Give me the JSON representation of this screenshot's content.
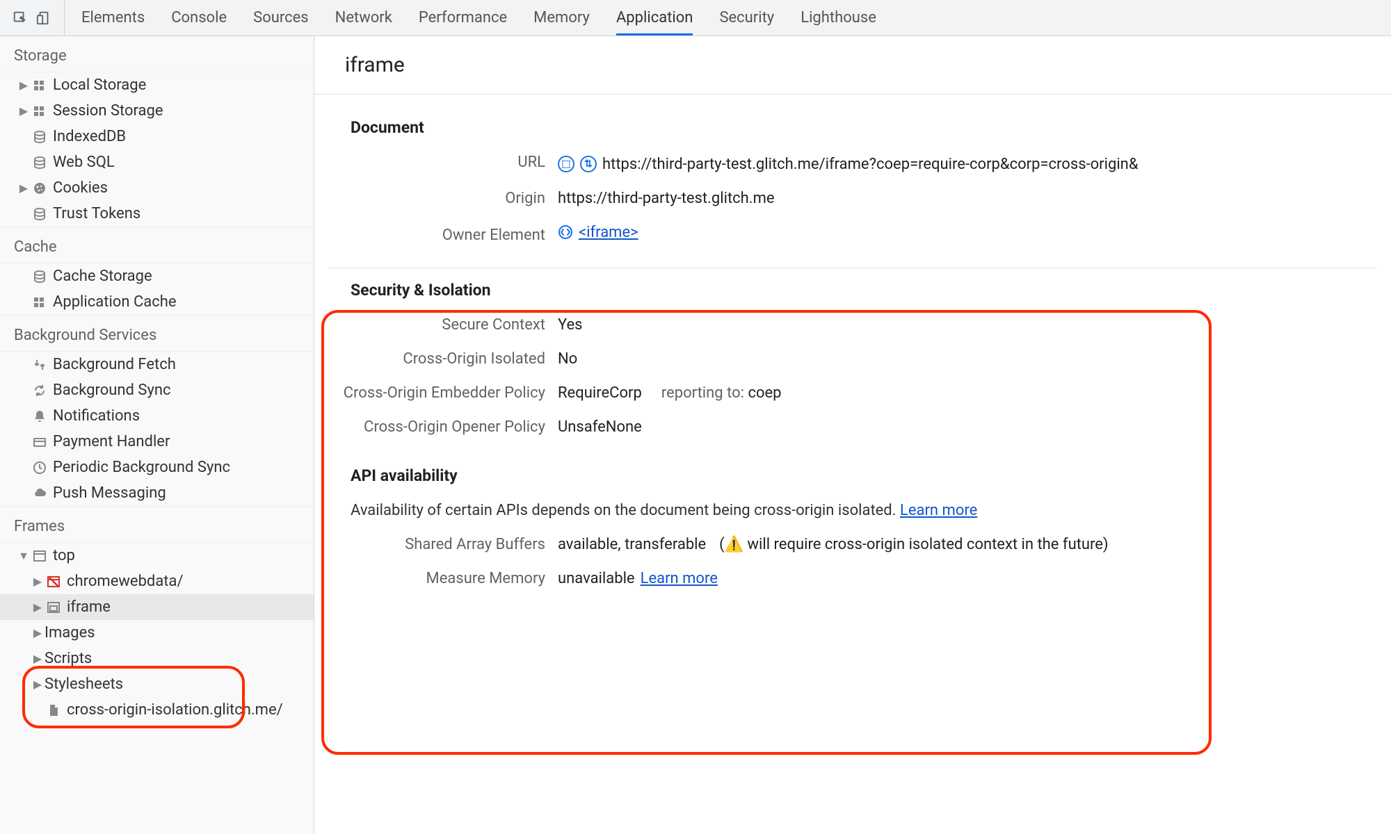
{
  "toolbar": {
    "tabs": [
      "Elements",
      "Console",
      "Sources",
      "Network",
      "Performance",
      "Memory",
      "Application",
      "Security",
      "Lighthouse"
    ],
    "active": "Application"
  },
  "sidebar": {
    "storage": {
      "header": "Storage",
      "items": [
        "Local Storage",
        "Session Storage",
        "IndexedDB",
        "Web SQL",
        "Cookies",
        "Trust Tokens"
      ]
    },
    "cache": {
      "header": "Cache",
      "items": [
        "Cache Storage",
        "Application Cache"
      ]
    },
    "background": {
      "header": "Background Services",
      "items": [
        "Background Fetch",
        "Background Sync",
        "Notifications",
        "Payment Handler",
        "Periodic Background Sync",
        "Push Messaging"
      ]
    },
    "frames": {
      "header": "Frames",
      "top": "top",
      "children": [
        "chromewebdata/",
        "iframe",
        "Images",
        "Scripts",
        "Stylesheets",
        "cross-origin-isolation.glitch.me/"
      ]
    }
  },
  "content": {
    "title": "iframe",
    "document": {
      "header": "Document",
      "url_label": "URL",
      "url_value": "https://third-party-test.glitch.me/iframe?coep=require-corp&corp=cross-origin&",
      "origin_label": "Origin",
      "origin_value": "https://third-party-test.glitch.me",
      "owner_label": "Owner Element",
      "owner_value": "<iframe>"
    },
    "security": {
      "header": "Security & Isolation",
      "secure_context_label": "Secure Context",
      "secure_context_value": "Yes",
      "coi_label": "Cross-Origin Isolated",
      "coi_value": "No",
      "coep_label": "Cross-Origin Embedder Policy",
      "coep_value": "RequireCorp",
      "reporting_label": "reporting to:",
      "reporting_value": "coep",
      "coop_label": "Cross-Origin Opener Policy",
      "coop_value": "UnsafeNone"
    },
    "api": {
      "header": "API availability",
      "desc": "Availability of certain APIs depends on the document being cross-origin isolated.",
      "learn_more": "Learn more",
      "sab_label": "Shared Array Buffers",
      "sab_value": "available, transferable",
      "sab_warn_prefix": "(",
      "sab_warning": " will require cross-origin isolated context in the future)",
      "mm_label": "Measure Memory",
      "mm_value": "unavailable"
    }
  }
}
